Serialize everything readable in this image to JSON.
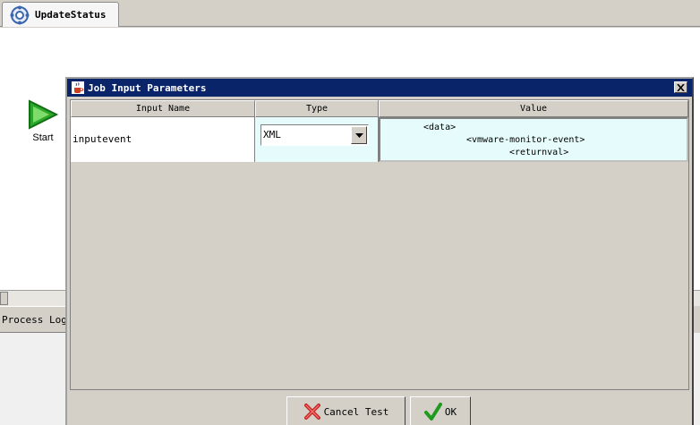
{
  "editor": {
    "tab_label": "UpdateStatus",
    "start_node_label": "Start",
    "process_log_tab": "Process Log"
  },
  "dialog": {
    "title": "Job Input Parameters",
    "columns": {
      "input_name": "Input Name",
      "type": "Type",
      "value": "Value"
    },
    "rows": [
      {
        "input_name": "inputevent",
        "type": "XML",
        "value_lines": [
          "<data>",
          "<vmware-monitor-event>",
          "<returnval>"
        ]
      }
    ],
    "buttons": {
      "cancel": "Cancel Test",
      "ok": "OK"
    }
  },
  "colors": {
    "title_bar": "#0a246a",
    "cell_highlight": "#e6fcfc",
    "window_face": "#d4d0c8"
  }
}
